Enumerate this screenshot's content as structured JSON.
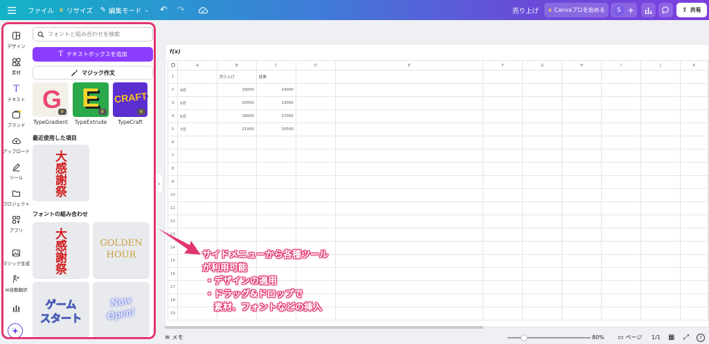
{
  "topbar": {
    "file_label": "ファイル",
    "resize_label": "リサイズ",
    "edit_mode_label": "編集モード",
    "design_title": "売り上げ",
    "canva_pro_label": "Canvaプロを始める",
    "avatar_letter": "S",
    "share_label": "共有"
  },
  "rail": [
    {
      "label": "デザイン",
      "icon": "layout-icon"
    },
    {
      "label": "素材",
      "icon": "elements-icon"
    },
    {
      "label": "テキスト",
      "icon": "text-icon"
    },
    {
      "label": "ブランド",
      "icon": "brand-icon"
    },
    {
      "label": "アップロード",
      "icon": "upload-icon"
    },
    {
      "label": "ツール",
      "icon": "pen-icon"
    },
    {
      "label": "プロジェクト",
      "icon": "folder-icon"
    },
    {
      "label": "アプリ",
      "icon": "apps-icon"
    },
    {
      "label": "マジック生成",
      "icon": "image-icon"
    },
    {
      "label": "AI自動翻訳",
      "icon": "translate-icon"
    },
    {
      "label": "",
      "icon": "chart-icon"
    }
  ],
  "panel": {
    "search_placeholder": "フォントと組み合わせを検索",
    "add_textbox_label": "テキストボックスを追加",
    "magic_write_label": "マジック作文",
    "effects": [
      {
        "label": "TypeGradient",
        "glyph": "G"
      },
      {
        "label": "TypeExtrude",
        "glyph": "E"
      },
      {
        "label": "TypeCraft",
        "glyph": "CRAFT"
      }
    ],
    "recent_title": "最近使用した項目",
    "recent_text": "大感謝祭",
    "combos_title": "フォントの組み合わせ",
    "combos": [
      {
        "text": "大感謝祭"
      },
      {
        "line1": "GOLDEN",
        "line2": "HOUR"
      },
      {
        "line1": "ゲーム",
        "line2": "スタート"
      },
      {
        "line1": "Now",
        "line2": "Open!"
      }
    ]
  },
  "sheet": {
    "fx_label": "f(x)",
    "columns": [
      "A",
      "B",
      "C",
      "D",
      "E",
      "F",
      "G",
      "H",
      "I",
      "J",
      "K"
    ],
    "row_numbers": [
      "1",
      "2",
      "3",
      "4",
      "5",
      "6",
      "7",
      "8",
      "9",
      "10",
      "11",
      "12",
      "13",
      "14",
      "15",
      "16",
      "17",
      "18",
      "19"
    ],
    "cells": [
      [
        "",
        "売り上げ",
        "経費"
      ],
      [
        "4月",
        "19000",
        "14000"
      ],
      [
        "5月",
        "20000",
        "13000"
      ],
      [
        "6月",
        "18000",
        "17000"
      ],
      [
        "7月",
        "21000",
        "20500"
      ]
    ]
  },
  "annotation": {
    "lines": [
      "サイドメニューから各種ツール",
      "が利用可能",
      "・デザインの適用",
      "・ドラッグ&ドロップで",
      "　素材、フォントなどの挿入"
    ]
  },
  "bottombar": {
    "memo_label": "メモ",
    "zoom_value": 0.8,
    "zoom_label": "80%",
    "page_label": "ページ",
    "page_count": "1/1"
  },
  "colors": {
    "accent_purple": "#8b3dff",
    "highlight_pink": "#e2356e"
  }
}
